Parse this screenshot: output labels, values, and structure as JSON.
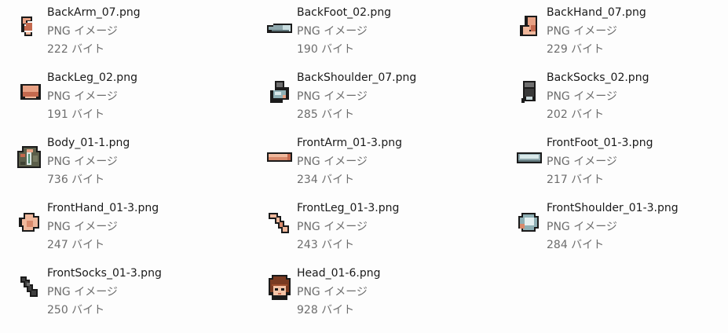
{
  "files": [
    {
      "name": "BackArm_07.png",
      "type": "PNG イメージ",
      "size": "222 バイト",
      "icon": "back-arm-thumbnail"
    },
    {
      "name": "BackFoot_02.png",
      "type": "PNG イメージ",
      "size": "190 バイト",
      "icon": "back-foot-thumbnail"
    },
    {
      "name": "BackHand_07.png",
      "type": "PNG イメージ",
      "size": "229 バイト",
      "icon": "back-hand-thumbnail"
    },
    {
      "name": "BackLeg_02.png",
      "type": "PNG イメージ",
      "size": "191 バイト",
      "icon": "back-leg-thumbnail"
    },
    {
      "name": "BackShoulder_07.png",
      "type": "PNG イメージ",
      "size": "285 バイト",
      "icon": "back-shoulder-thumbnail"
    },
    {
      "name": "BackSocks_02.png",
      "type": "PNG イメージ",
      "size": "202 バイト",
      "icon": "back-socks-thumbnail"
    },
    {
      "name": "Body_01-1.png",
      "type": "PNG イメージ",
      "size": "736 バイト",
      "icon": "body-thumbnail"
    },
    {
      "name": "FrontArm_01-3.png",
      "type": "PNG イメージ",
      "size": "234 バイト",
      "icon": "front-arm-thumbnail"
    },
    {
      "name": "FrontFoot_01-3.png",
      "type": "PNG イメージ",
      "size": "217 バイト",
      "icon": "front-foot-thumbnail"
    },
    {
      "name": "FrontHand_01-3.png",
      "type": "PNG イメージ",
      "size": "247 バイト",
      "icon": "front-hand-thumbnail"
    },
    {
      "name": "FrontLeg_01-3.png",
      "type": "PNG イメージ",
      "size": "243 バイト",
      "icon": "front-leg-thumbnail"
    },
    {
      "name": "FrontShoulder_01-3.png",
      "type": "PNG イメージ",
      "size": "284 バイト",
      "icon": "front-shoulder-thumbnail"
    },
    {
      "name": "FrontSocks_01-3.png",
      "type": "PNG イメージ",
      "size": "250 バイト",
      "icon": "front-socks-thumbnail"
    },
    {
      "name": "Head_01-6.png",
      "type": "PNG イメージ",
      "size": "928 バイト",
      "icon": "head-thumbnail"
    }
  ]
}
